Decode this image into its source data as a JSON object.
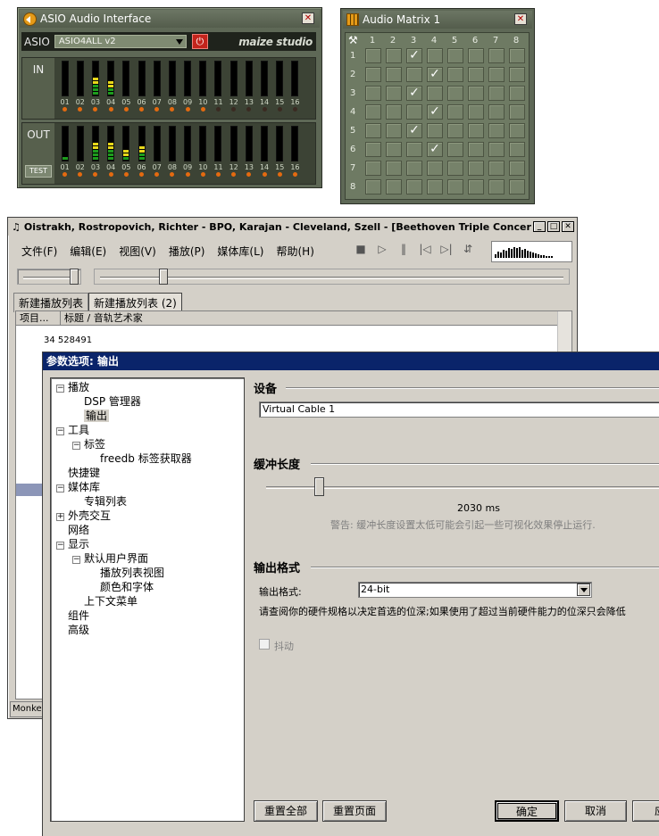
{
  "asio": {
    "title": "ASIO Audio Interface",
    "label": "ASIO",
    "driver": "ASIO4ALL v2",
    "brand": "maize studio",
    "in_label": "IN",
    "out_label": "OUT",
    "test_label": "TEST",
    "channels": [
      "01",
      "02",
      "03",
      "04",
      "05",
      "06",
      "07",
      "08",
      "09",
      "10",
      "11",
      "12",
      "13",
      "14",
      "15",
      "16"
    ],
    "in_levels": [
      0,
      0,
      5,
      4,
      0,
      0,
      0,
      0,
      0,
      0,
      0,
      0,
      0,
      0,
      0,
      0
    ],
    "out_levels": [
      1,
      0,
      5,
      5,
      3,
      4,
      0,
      0,
      0,
      0,
      0,
      0,
      0,
      0,
      0,
      0
    ],
    "in_leds_on": [
      1,
      1,
      1,
      1,
      1,
      1,
      1,
      1,
      1,
      1,
      0,
      0,
      0,
      0,
      0,
      0
    ],
    "out_leds_on": [
      1,
      1,
      1,
      1,
      1,
      1,
      1,
      1,
      1,
      1,
      1,
      1,
      1,
      1,
      1,
      1
    ]
  },
  "matrix": {
    "title": "Audio Matrix 1",
    "cols": [
      "1",
      "2",
      "3",
      "4",
      "5",
      "6",
      "7",
      "8"
    ],
    "rows": [
      "1",
      "2",
      "3",
      "4",
      "5",
      "6",
      "7",
      "8"
    ],
    "checked": [
      [
        1,
        3
      ],
      [
        2,
        4
      ],
      [
        3,
        3
      ],
      [
        4,
        4
      ],
      [
        5,
        3
      ],
      [
        6,
        4
      ]
    ],
    "check_mark": "✓"
  },
  "player": {
    "title": "Oistrakh, Rostropovich, Richter - BPO, Karajan - Cleveland, Szell - [Beethoven Triple Concerto, Bra...",
    "menu": [
      "文件(F)",
      "编辑(E)",
      "视图(V)",
      "播放(P)",
      "媒体库(L)",
      "帮助(H)"
    ],
    "tabs": [
      "新建播放列表",
      "新建播放列表 (2)"
    ],
    "columns": [
      "项目...",
      "标题 / 音轨艺术家"
    ],
    "rows": [
      {
        "num": "34",
        "title": "528491"
      }
    ],
    "status": "Monkey"
  },
  "prefs": {
    "title": "参数选项: 输出",
    "tree": [
      {
        "label": "播放",
        "level": 0,
        "box": "−"
      },
      {
        "label": "DSP 管理器",
        "level": 1
      },
      {
        "label": "输出",
        "level": 1,
        "selected": true
      },
      {
        "label": "工具",
        "level": 0,
        "box": "−"
      },
      {
        "label": "标签",
        "level": 1,
        "box": "−"
      },
      {
        "label": "freedb 标签获取器",
        "level": 2
      },
      {
        "label": "快捷键",
        "level": 0
      },
      {
        "label": "媒体库",
        "level": 0,
        "box": "−"
      },
      {
        "label": "专辑列表",
        "level": 1
      },
      {
        "label": "外壳交互",
        "level": 0,
        "box": "+"
      },
      {
        "label": "网络",
        "level": 0
      },
      {
        "label": "显示",
        "level": 0,
        "box": "−"
      },
      {
        "label": "默认用户界面",
        "level": 1,
        "box": "−"
      },
      {
        "label": "播放列表视图",
        "level": 2
      },
      {
        "label": "颜色和字体",
        "level": 2
      },
      {
        "label": "上下文菜单",
        "level": 1
      },
      {
        "label": "组件",
        "level": 0
      },
      {
        "label": "高级",
        "level": 0
      }
    ],
    "device_header": "设备",
    "device": "Virtual Cable 1",
    "buffer_header": "缓冲长度",
    "buffer_value": "2030 ms",
    "buffer_fraction": 0.13,
    "buffer_warning": "警告: 缓冲长度设置太低可能会引起一些可视化效果停止运行.",
    "format_header": "输出格式",
    "format_label": "输出格式:",
    "format_value": "24-bit",
    "format_note": "请查阅你的硬件规格以决定首选的位深;如果使用了超过当前硬件能力的位深只会降低",
    "dither": "抖动",
    "buttons": {
      "reset_all": "重置全部",
      "reset_page": "重置页面",
      "ok": "确定",
      "cancel": "取消",
      "apply": "应"
    }
  }
}
